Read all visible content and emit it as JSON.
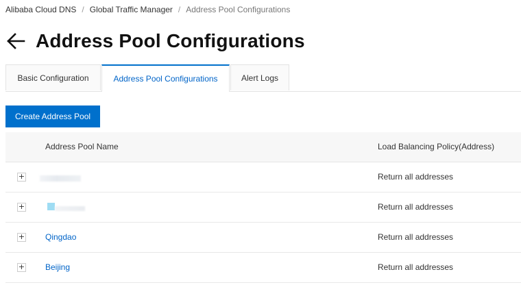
{
  "breadcrumb": {
    "items": [
      {
        "label": "Alibaba Cloud DNS"
      },
      {
        "label": "Global Traffic Manager"
      },
      {
        "label": "Address Pool Configurations"
      }
    ],
    "separator": "/"
  },
  "header": {
    "back_icon": "arrow-left-icon",
    "title": "Address Pool Configurations"
  },
  "tabs": [
    {
      "label": "Basic Configuration",
      "active": false
    },
    {
      "label": "Address Pool Configurations",
      "active": true
    },
    {
      "label": "Alert Logs",
      "active": false
    }
  ],
  "toolbar": {
    "create_label": "Create Address Pool"
  },
  "table": {
    "columns": [
      "Address Pool Name",
      "Load Balancing Policy(Address)"
    ],
    "expand_symbol": "+",
    "rows": [
      {
        "name": "",
        "policy": "Return all addresses",
        "redacted": true
      },
      {
        "name": "",
        "policy": "Return all addresses",
        "redacted": true
      },
      {
        "name": "Qingdao",
        "policy": "Return all addresses",
        "redacted": false
      },
      {
        "name": "Beijing",
        "policy": "Return all addresses",
        "redacted": false
      }
    ]
  },
  "colors": {
    "primary": "#0070cc",
    "link": "#0064c8",
    "header_bg": "#f7f7f7"
  }
}
